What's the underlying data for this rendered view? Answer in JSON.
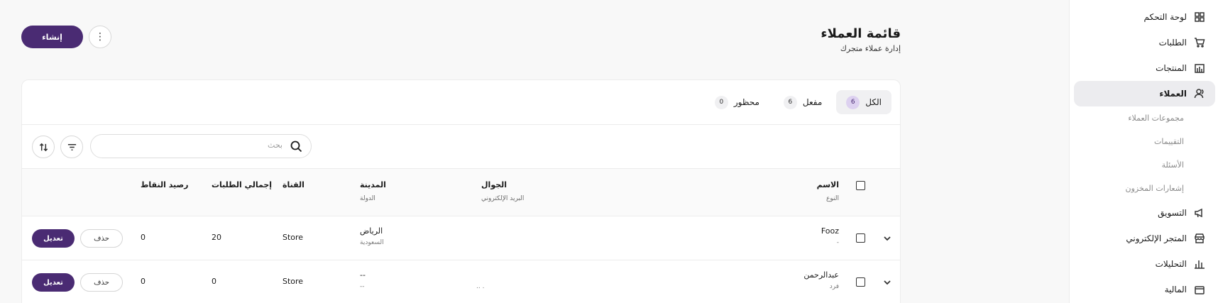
{
  "sidebar": {
    "items": [
      {
        "label": "لوحة التحكم",
        "icon": "dashboard-icon"
      },
      {
        "label": "الطلبات",
        "icon": "cart-icon"
      },
      {
        "label": "المنتجات",
        "icon": "products-icon"
      },
      {
        "label": "العملاء",
        "icon": "users-icon"
      },
      {
        "label": "التسويق",
        "icon": "megaphone-icon"
      },
      {
        "label": "المتجر الإلكتروني",
        "icon": "store-icon"
      },
      {
        "label": "التحليلات",
        "icon": "bar-chart-icon"
      },
      {
        "label": "المالية",
        "icon": "wallet-icon"
      }
    ],
    "sub_items": [
      "مجموعات العملاء",
      "التقييمات",
      "الأسئلة",
      "إشعارات المخزون"
    ]
  },
  "header": {
    "title": "قائمة العملاء",
    "subtitle": "إدارة عملاء متجرك",
    "create_label": "إنشاء",
    "more_label": "⋮"
  },
  "tabs": [
    {
      "label": "الكل",
      "count": "6"
    },
    {
      "label": "مفعل",
      "count": "6"
    },
    {
      "label": "محظور",
      "count": "0"
    }
  ],
  "search": {
    "placeholder": "بحث"
  },
  "table": {
    "headers": {
      "name": "الاسم",
      "type": "النوع",
      "mobile": "الجوال",
      "email": "البريد الإلكتروني",
      "city": "المدينة",
      "country": "الدولة",
      "channel": "القناة",
      "total_orders": "إجمالي الطلبات",
      "points": "رصيد النقاط"
    },
    "rows": [
      {
        "name": "Fooz",
        "type": "-",
        "mobile": "",
        "email": "",
        "city": "الرياض",
        "country": "السعودية",
        "channel": "Store",
        "total_orders": "20",
        "points": "0",
        "delete_label": "حذف",
        "edit_label": "تعديل"
      },
      {
        "name": "عبدالرحمن",
        "type": "فرد",
        "mobile": "",
        "email": ".        ..",
        "city": "--",
        "country": "--",
        "channel": "Store",
        "total_orders": "0",
        "points": "0",
        "delete_label": "حذف",
        "edit_label": "تعديل"
      }
    ]
  },
  "colors": {
    "accent": "#4a2b73",
    "active_bg": "#ececef",
    "count_active_bg": "#ddd1f0"
  }
}
